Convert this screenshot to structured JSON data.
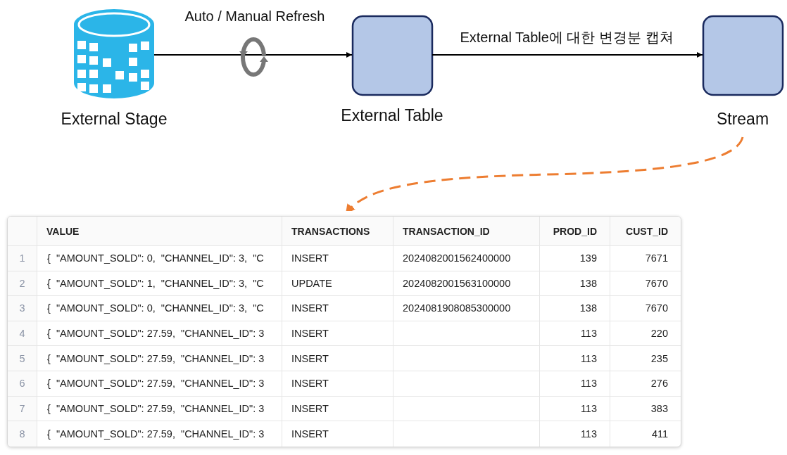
{
  "diagram": {
    "nodes": [
      {
        "kind": "stage",
        "label": "External Stage"
      },
      {
        "kind": "box",
        "label": "External Table"
      },
      {
        "kind": "box",
        "label": "Stream"
      }
    ],
    "edges": [
      {
        "refresh_icon": true,
        "label": "Auto / Manual Refresh"
      },
      {
        "label": "External Table에 대한 변경분 캡쳐"
      }
    ]
  },
  "table": {
    "columns": [
      {
        "label": "VALUE",
        "numeric": false
      },
      {
        "label": "TRANSACTIONS",
        "numeric": false
      },
      {
        "label": "TRANSACTION_ID",
        "numeric": false
      },
      {
        "label": "PROD_ID",
        "numeric": true
      },
      {
        "label": "CUST_ID",
        "numeric": true
      }
    ],
    "rows": [
      {
        "number": "1",
        "cells": [
          "{  \"AMOUNT_SOLD\": 0,  \"CHANNEL_ID\": 3,  \"C",
          "INSERT",
          "2024082001562400000",
          "139",
          "7671"
        ]
      },
      {
        "number": "2",
        "cells": [
          "{  \"AMOUNT_SOLD\": 1,  \"CHANNEL_ID\": 3,  \"C",
          "UPDATE",
          "2024082001563100000",
          "138",
          "7670"
        ]
      },
      {
        "number": "3",
        "cells": [
          "{  \"AMOUNT_SOLD\": 0,  \"CHANNEL_ID\": 3,  \"C",
          "INSERT",
          "2024081908085300000",
          "138",
          "7670"
        ]
      },
      {
        "number": "4",
        "cells": [
          "{  \"AMOUNT_SOLD\": 27.59,  \"CHANNEL_ID\": 3",
          "INSERT",
          null,
          "113",
          "220"
        ]
      },
      {
        "number": "5",
        "cells": [
          "{  \"AMOUNT_SOLD\": 27.59,  \"CHANNEL_ID\": 3",
          "INSERT",
          null,
          "113",
          "235"
        ]
      },
      {
        "number": "6",
        "cells": [
          "{  \"AMOUNT_SOLD\": 27.59,  \"CHANNEL_ID\": 3",
          "INSERT",
          null,
          "113",
          "276"
        ]
      },
      {
        "number": "7",
        "cells": [
          "{  \"AMOUNT_SOLD\": 27.59,  \"CHANNEL_ID\": 3",
          "INSERT",
          null,
          "113",
          "383"
        ]
      },
      {
        "number": "8",
        "cells": [
          "{  \"AMOUNT_SOLD\": 27.59,  \"CHANNEL_ID\": 3",
          "INSERT",
          null,
          "113",
          "411"
        ]
      }
    ]
  }
}
